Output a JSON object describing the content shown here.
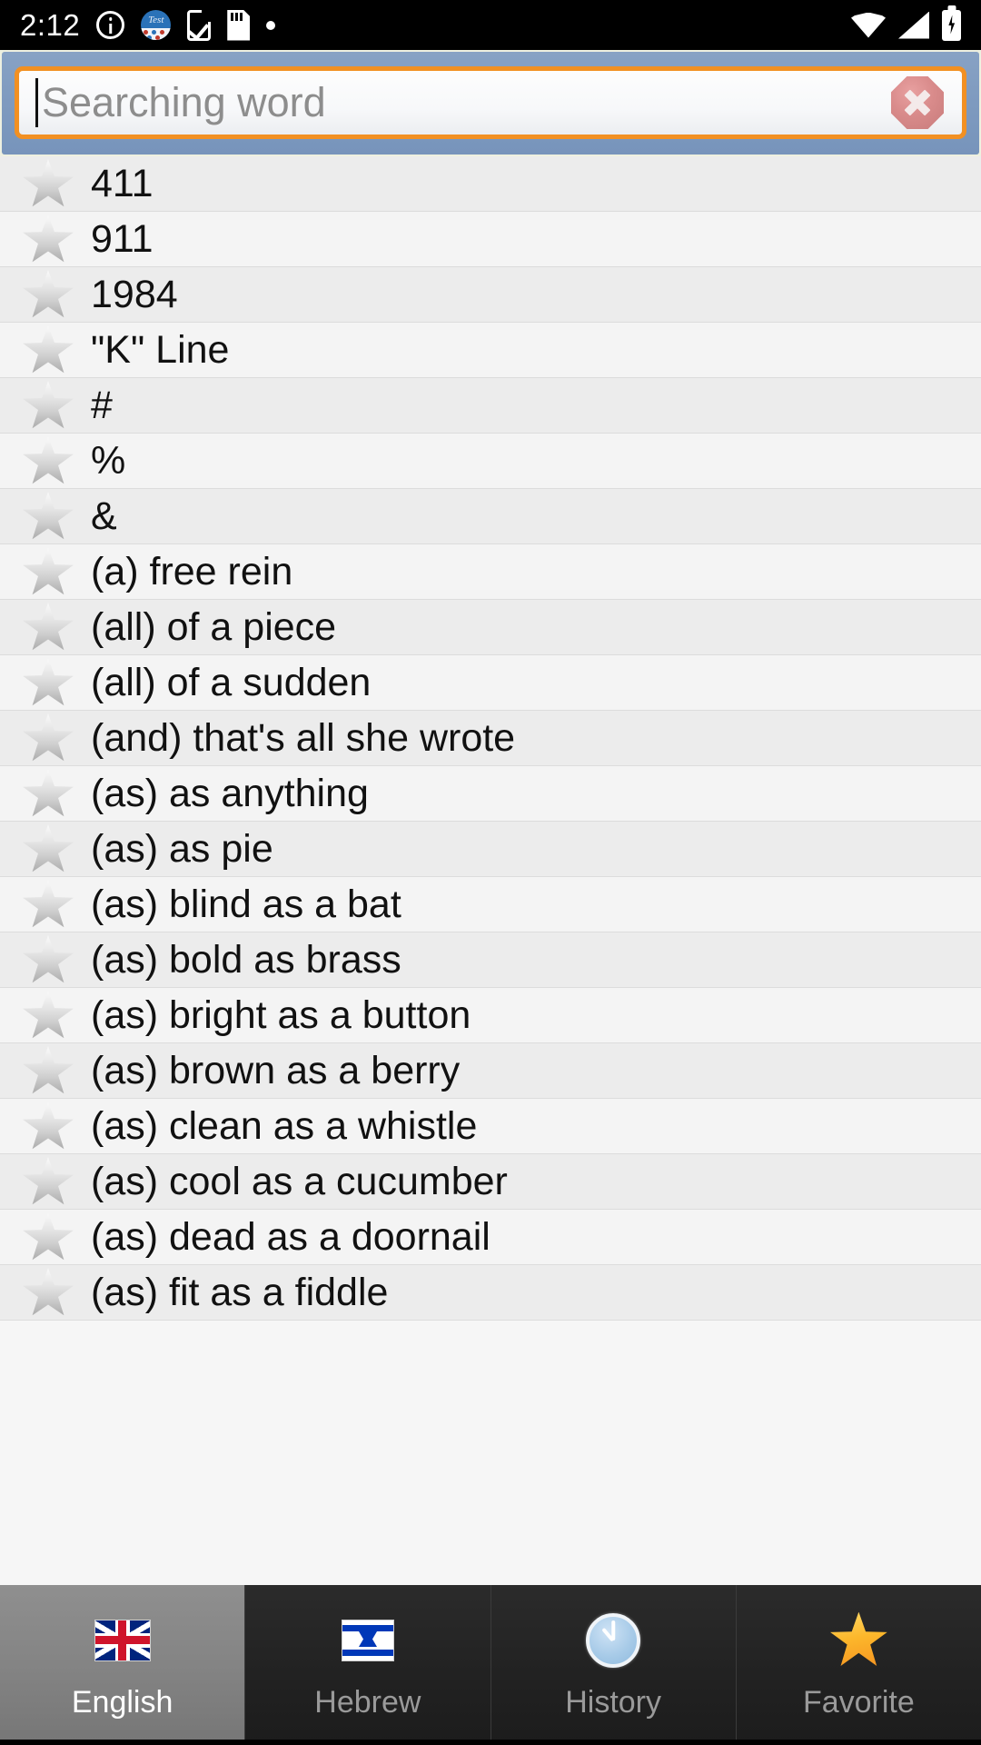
{
  "status_bar": {
    "time": "2:12",
    "left_icons": [
      "info-icon",
      "test-app-icon",
      "phone-check-icon",
      "sdcard-icon",
      "dot-icon"
    ],
    "right_icons": [
      "wifi-icon",
      "cellular-signal-icon",
      "battery-charging-icon"
    ],
    "test_app_label": "Test"
  },
  "search": {
    "placeholder": "Searching word",
    "value": "",
    "clear_icon": "clear-octagon-icon",
    "accent_border": "#f29022",
    "panel_color": "#7e9abf"
  },
  "list": {
    "items": [
      {
        "word": "411"
      },
      {
        "word": "911"
      },
      {
        "word": "1984"
      },
      {
        "word": "\"K\" Line"
      },
      {
        "word": "#"
      },
      {
        "word": "%"
      },
      {
        "word": "&"
      },
      {
        "word": "(a) free rein"
      },
      {
        "word": "(all) of a piece"
      },
      {
        "word": "(all) of a sudden"
      },
      {
        "word": "(and) that's all she wrote"
      },
      {
        "word": "(as) as anything"
      },
      {
        "word": "(as) as pie"
      },
      {
        "word": "(as) blind as a bat"
      },
      {
        "word": "(as) bold as brass"
      },
      {
        "word": "(as) bright as a button"
      },
      {
        "word": "(as) brown as a berry"
      },
      {
        "word": "(as) clean as a whistle"
      },
      {
        "word": "(as) cool as a cucumber"
      },
      {
        "word": "(as) dead as a doornail"
      },
      {
        "word": "(as) fit as a fiddle"
      }
    ],
    "favorite_icon": "star-outline-icon"
  },
  "tabs": [
    {
      "label": "English",
      "icon": "uk-flag-icon",
      "active": true
    },
    {
      "label": "Hebrew",
      "icon": "israel-flag-icon",
      "active": false
    },
    {
      "label": "History",
      "icon": "clock-icon",
      "active": false
    },
    {
      "label": "Favorite",
      "icon": "gold-star-icon",
      "active": false
    }
  ]
}
